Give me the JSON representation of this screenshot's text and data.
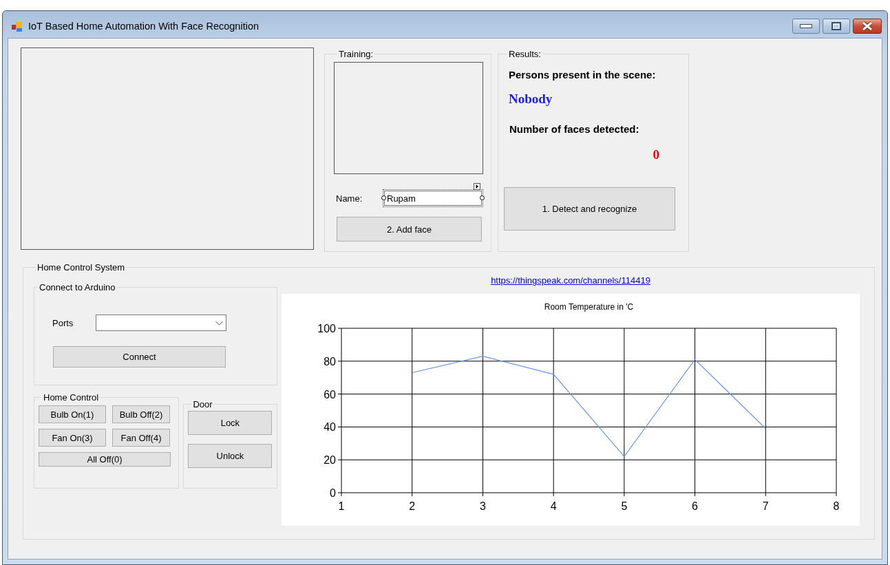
{
  "window": {
    "title": "IoT Based Home Automation With Face Recognition"
  },
  "training": {
    "title": "Training:",
    "name_label": "Name:",
    "name_value": "Rupam",
    "add_button": "2. Add face"
  },
  "results": {
    "title": "Results:",
    "persons_label": "Persons present in the scene:",
    "persons_value": "Nobody",
    "faces_label": "Number of faces detected:",
    "faces_value": "0",
    "detect_button": "1. Detect and recognize"
  },
  "home_control_system": {
    "title": "Home Control System",
    "connect": {
      "title": "Connect to Arduino",
      "ports_label": "Ports",
      "connect_button": "Connect"
    },
    "home_control": {
      "title": "Home Control",
      "buttons": [
        "Bulb On(1)",
        "Bulb Off(2)",
        "Fan On(3)",
        "Fan Off(4)",
        "All Off(0)"
      ]
    },
    "door": {
      "title": "Door",
      "buttons": [
        "Lock",
        "Unlock"
      ]
    },
    "link": "https://thingspeak.com/channels/114419",
    "chart": {
      "chart_data": {
        "type": "line",
        "title": "Room Temperature in 'C",
        "x": [
          2,
          3,
          4,
          5,
          6,
          7
        ],
        "values": [
          73,
          83,
          72,
          22,
          81,
          39
        ],
        "grid": true,
        "xlim": [
          1,
          8
        ],
        "ylim": [
          0,
          100
        ],
        "xticks": [
          1,
          2,
          3,
          4,
          5,
          6,
          7,
          8
        ],
        "yticks": [
          0,
          20,
          40,
          60,
          80,
          100
        ]
      }
    }
  }
}
